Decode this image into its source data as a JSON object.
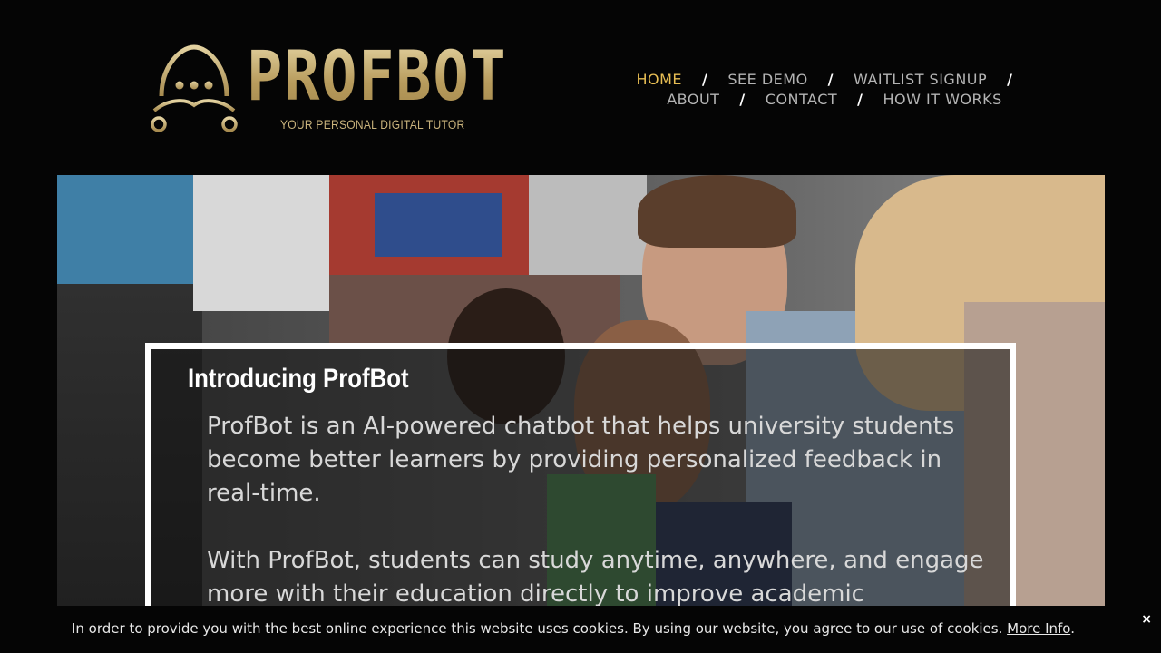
{
  "brand": {
    "name": "PROFBOT",
    "tagline": "YOUR PERSONAL DIGITAL TUTOR",
    "logo_icon": "robot-face-icon",
    "gold": "#c9b37c"
  },
  "nav": {
    "row1": [
      {
        "label": "HOME",
        "active": true
      },
      {
        "label": "SEE DEMO"
      },
      {
        "label": "WAITLIST SIGNUP"
      }
    ],
    "row2": [
      {
        "label": "ABOUT"
      },
      {
        "label": "CONTACT"
      },
      {
        "label": "HOW IT WORKS"
      }
    ],
    "separator": "/",
    "active_color": "#e8be54"
  },
  "hero": {
    "image_alt": "students studying",
    "title": "Introducing ProfBot",
    "paragraph1": "ProfBot is an AI-powered chatbot that helps university students become better learners by providing personalized feedback in real-time.",
    "paragraph2": "With ProfBot, students can study anytime, anywhere, and engage more with their education directly to improve academic"
  },
  "cookie_bar": {
    "text": "In order to provide you with the best online experience this website uses cookies. By using our website, you agree to our use of cookies.",
    "link_label": "More Info",
    "trailing": ".",
    "close_label": "×"
  }
}
